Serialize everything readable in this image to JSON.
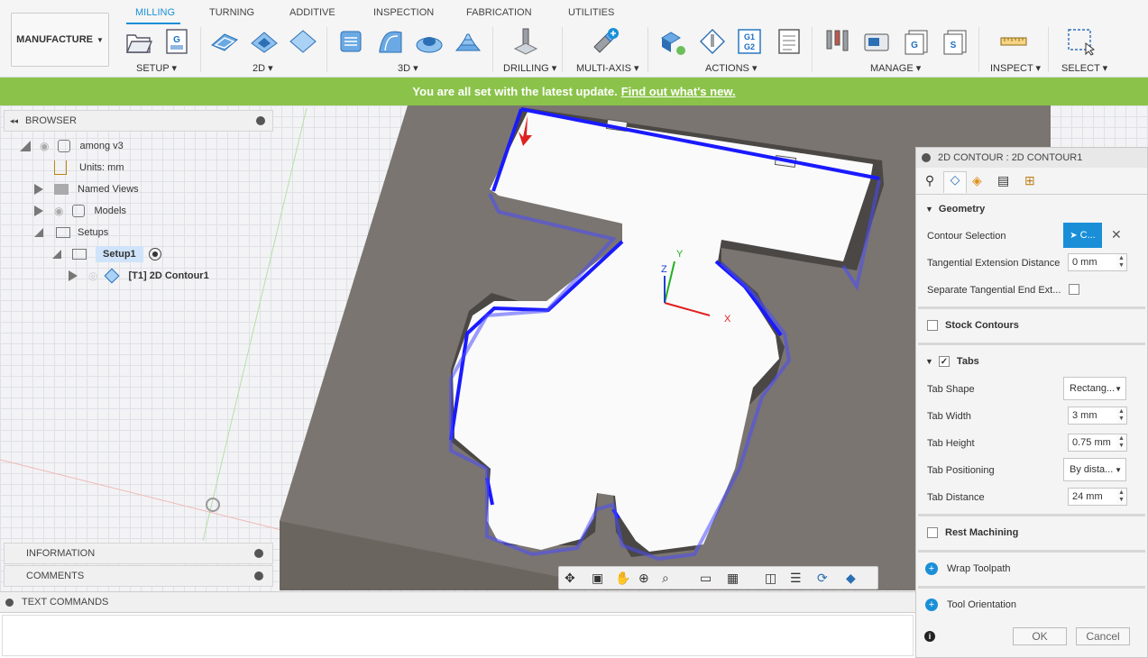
{
  "workspace": {
    "label": "MANUFACTURE"
  },
  "tabs": [
    "MILLING",
    "TURNING",
    "ADDITIVE",
    "INSPECTION",
    "FABRICATION",
    "UTILITIES"
  ],
  "groups": [
    "SETUP",
    "2D",
    "3D",
    "DRILLING",
    "MULTI-AXIS",
    "ACTIONS",
    "MANAGE",
    "INSPECT",
    "SELECT"
  ],
  "action_icon_text": "G1\nG2",
  "banner": {
    "text": "You are all set with the latest update.",
    "link": "Find out what's new."
  },
  "browser": {
    "title": "BROWSER",
    "items": [
      {
        "label": "among v3"
      },
      {
        "label": "Units: mm"
      },
      {
        "label": "Named Views"
      },
      {
        "label": "Models"
      },
      {
        "label": "Setups"
      },
      {
        "label": "Setup1"
      },
      {
        "label": "[T1] 2D Contour1"
      }
    ]
  },
  "panels": {
    "information": "INFORMATION",
    "comments": "COMMENTS",
    "text_commands": "TEXT COMMANDS"
  },
  "axes": {
    "x": "X",
    "y": "Y",
    "z": "Z"
  },
  "dialog": {
    "title": "2D CONTOUR : 2D CONTOUR1",
    "geometry": {
      "title": "Geometry",
      "contour_selection_label": "Contour Selection",
      "contour_selection_value": "C...",
      "tangential_ext_label": "Tangential Extension Distance",
      "tangential_ext_value": "0 mm",
      "separate_tangential_label": "Separate Tangential End Ext..."
    },
    "stock_contours": "Stock Contours",
    "tabs_section": {
      "title": "Tabs",
      "shape_label": "Tab Shape",
      "shape_value": "Rectang...",
      "width_label": "Tab Width",
      "width_value": "3 mm",
      "height_label": "Tab Height",
      "height_value": "0.75 mm",
      "positioning_label": "Tab Positioning",
      "positioning_value": "By dista...",
      "distance_label": "Tab Distance",
      "distance_value": "24 mm"
    },
    "rest_machining": "Rest Machining",
    "wrap_toolpath": "Wrap Toolpath",
    "tool_orientation": "Tool Orientation",
    "ok": "OK",
    "cancel": "Cancel"
  },
  "colors": {
    "accent": "#1a8fd8",
    "banner": "#8bc34a",
    "toolpath": "#1a1aff",
    "stock": "#7a7570"
  }
}
